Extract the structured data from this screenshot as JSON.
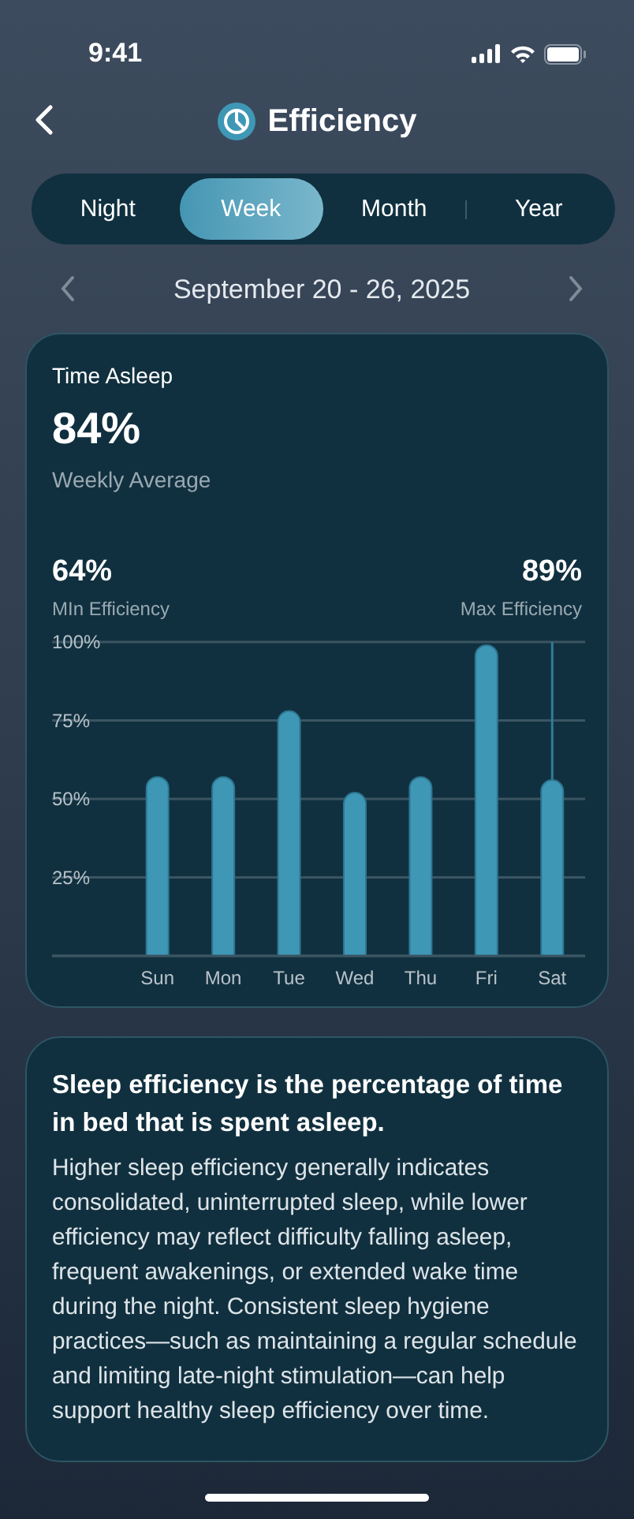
{
  "status_bar": {
    "time": "9:41"
  },
  "nav": {
    "title": "Efficiency"
  },
  "tabs": [
    {
      "label": "Night",
      "selected": false
    },
    {
      "label": "Week",
      "selected": true
    },
    {
      "label": "Month",
      "selected": false
    },
    {
      "label": "Year",
      "selected": false
    }
  ],
  "date_range": "September 20 - 26, 2025",
  "summary": {
    "label": "Time Asleep",
    "value": "84%",
    "caption": "Weekly Average",
    "stats": [
      {
        "value": "64%",
        "label": "MIn Efficiency"
      },
      {
        "value": "89%",
        "label": "Max Efficiency"
      }
    ],
    "chart_data": {
      "type": "bar",
      "categories": [
        "Sun",
        "Mon",
        "Tue",
        "Wed",
        "Thu",
        "Fri",
        "Sat"
      ],
      "series": [
        {
          "color": "#3f97b6",
          "values": [
            57,
            57,
            78,
            52,
            57,
            99,
            56
          ]
        }
      ],
      "ylim": [
        0,
        100
      ],
      "yticks": [
        {
          "value": 25,
          "label": "25%"
        },
        {
          "value": 50,
          "label": "50%"
        },
        {
          "value": 75,
          "label": "75%"
        },
        {
          "value": 100,
          "label": "100%"
        }
      ],
      "grid": true,
      "ref_lines": [
        {
          "axis": "x",
          "value": "Sat"
        }
      ]
    }
  },
  "info": {
    "heading": "Sleep efficiency is the percentage of time in bed that is spent asleep.",
    "body": "Higher sleep efficiency generally indicates consolidated, uninterrupted sleep, while lower efficiency may reflect difficulty falling asleep, frequent awakenings, or extended wake time during the night. Consistent sleep hygiene practices—such as maintaining a regular schedule and limiting late-night stimulation—can help support healthy sleep efficiency over time."
  }
}
